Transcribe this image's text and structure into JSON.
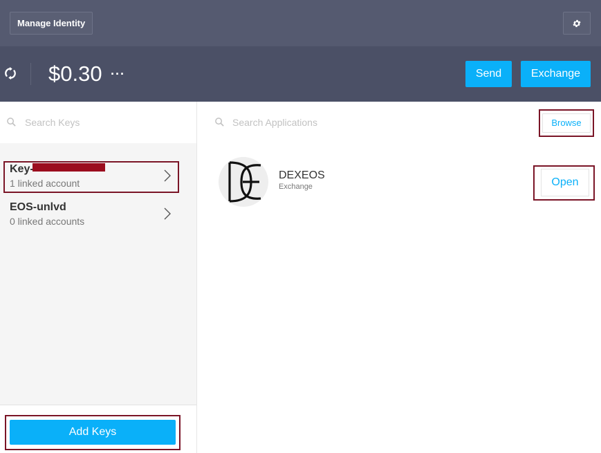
{
  "header": {
    "manage_identity_label": "Manage Identity"
  },
  "balance_bar": {
    "balance": "$0.30",
    "more_label": "···",
    "send_label": "Send",
    "exchange_label": "Exchange"
  },
  "keys_panel": {
    "search_placeholder": "Search Keys",
    "keys": [
      {
        "name": "Key-",
        "subtitle": "1 linked account"
      },
      {
        "name": "EOS-unlvd",
        "subtitle": "0 linked accounts"
      }
    ],
    "add_keys_label": "Add Keys"
  },
  "apps_panel": {
    "search_placeholder": "Search Applications",
    "browse_label": "Browse",
    "apps": [
      {
        "name": "DEXEOS",
        "type": "Exchange",
        "open_label": "Open"
      }
    ]
  },
  "colors": {
    "accent": "#0ab0f9",
    "header_bg": "#555a70",
    "balance_bg": "#4b5066",
    "highlight": "#7a1426"
  }
}
